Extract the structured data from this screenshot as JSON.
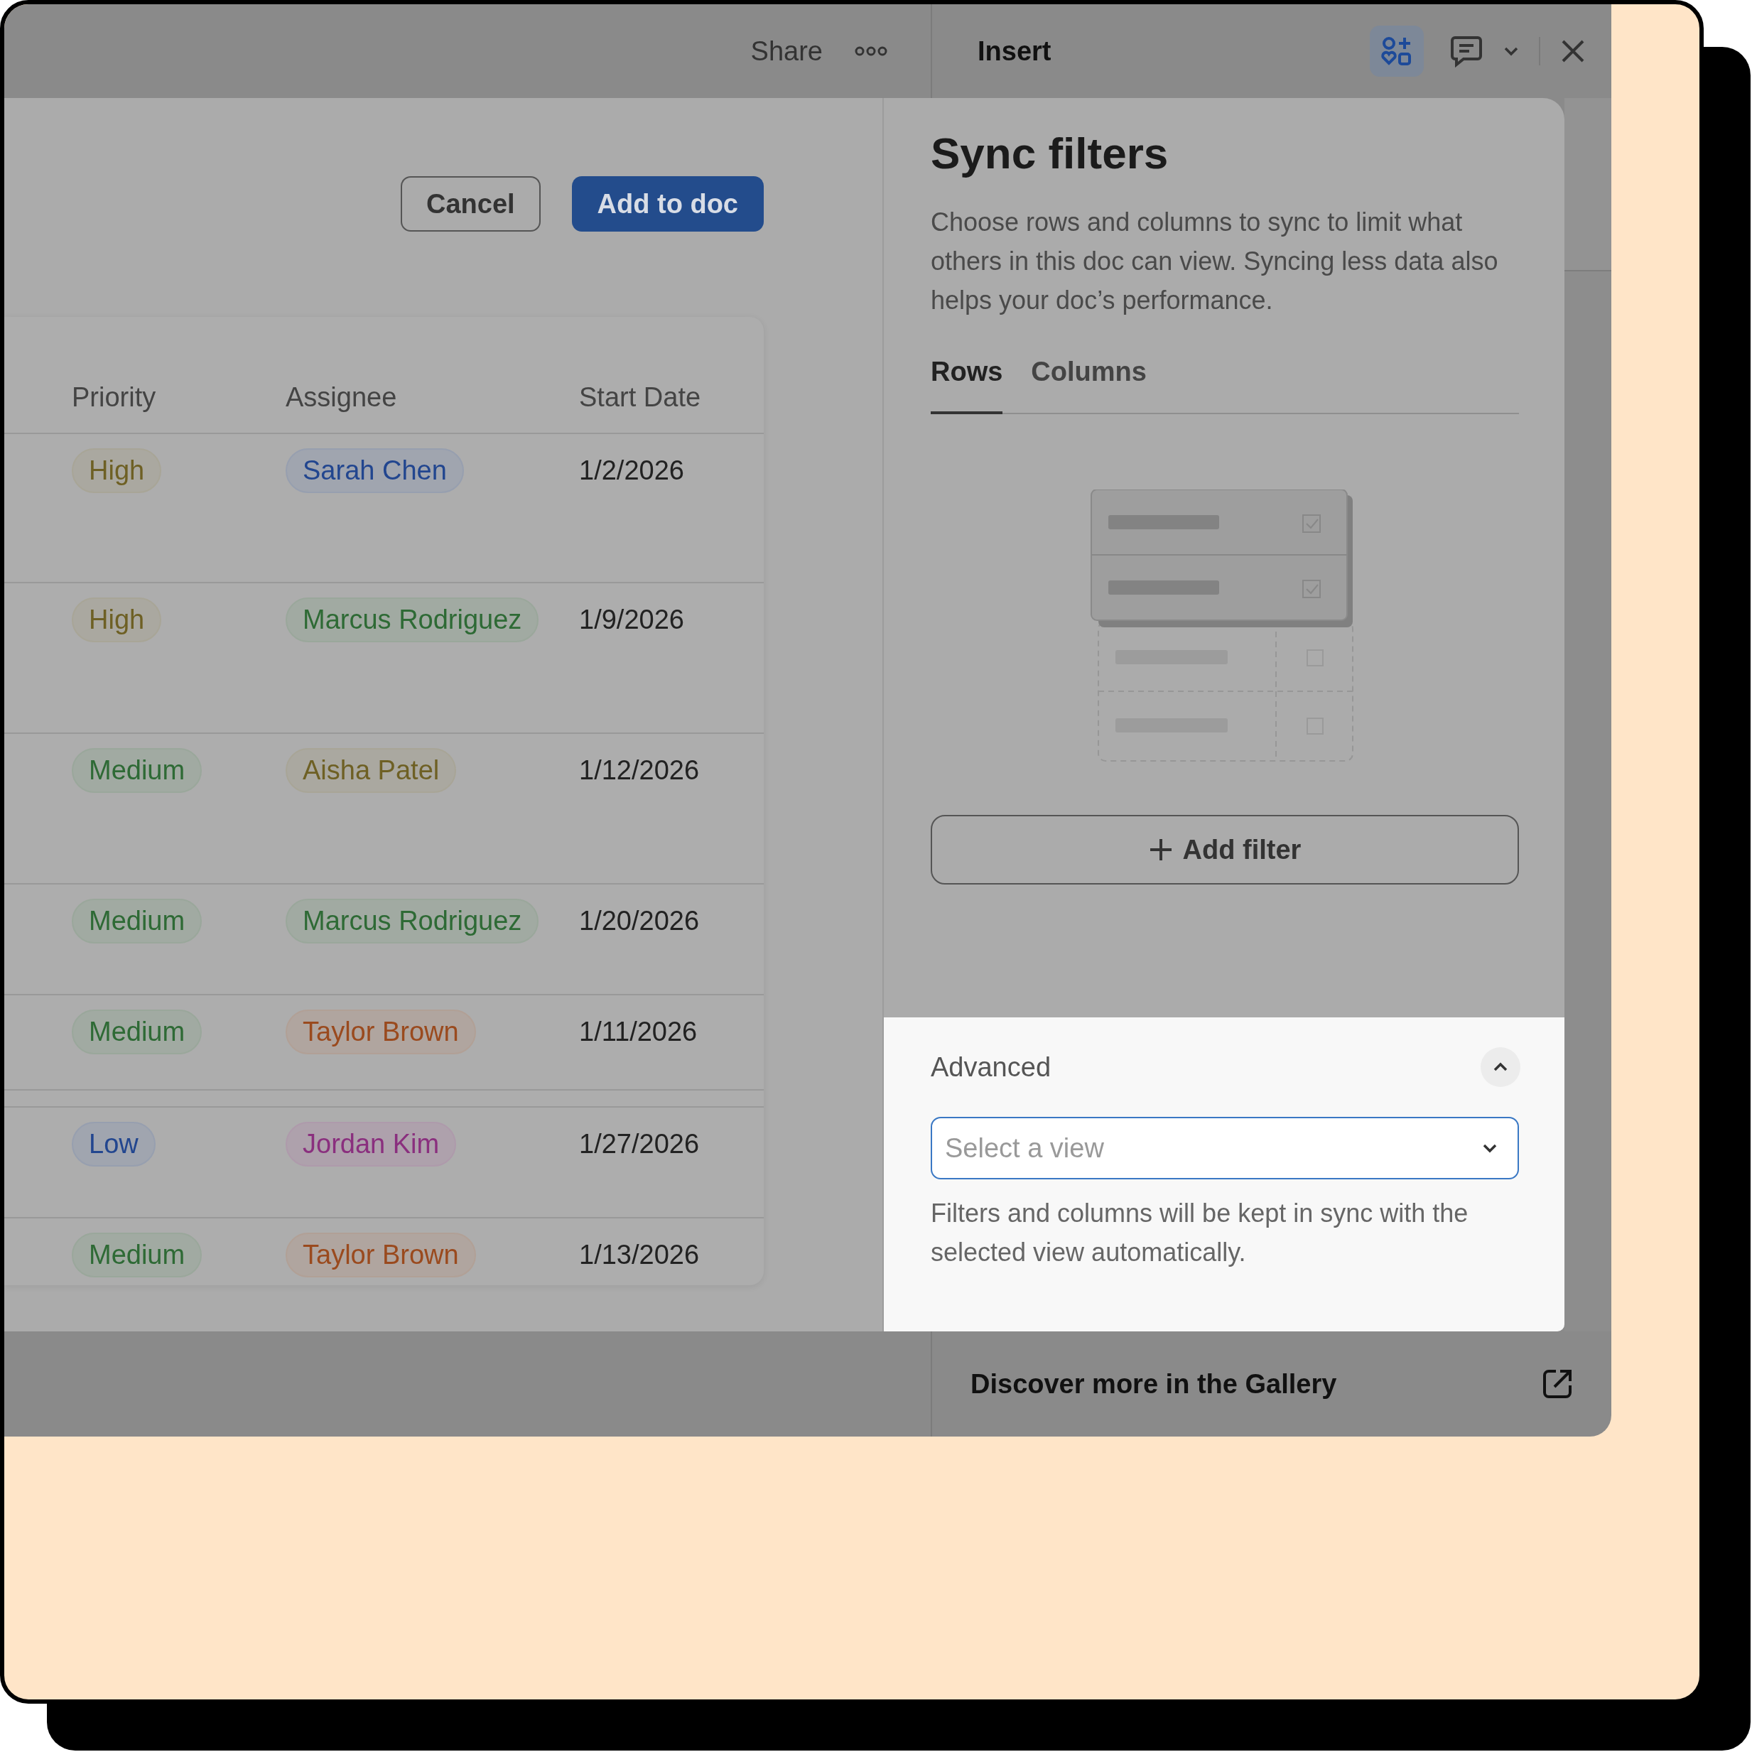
{
  "top_bar": {
    "share": "Share",
    "panel_title": "Insert"
  },
  "dialog": {
    "buttons": [
      {
        "label": "Cancel",
        "kind": "secondary"
      },
      {
        "label": "Add to doc",
        "kind": "primary"
      }
    ]
  },
  "table": {
    "columns": [
      "Priority",
      "Assignee",
      "Start Date"
    ],
    "rows": [
      {
        "priority": {
          "label": "High",
          "color": "#6e6024"
        },
        "assignee": {
          "label": "Sarah Chen",
          "color": "#22468f"
        },
        "start_date": "1/2/2026"
      },
      {
        "priority": {
          "label": "High",
          "color": "#6e6024"
        },
        "assignee": {
          "label": "Marcus Rodriguez",
          "color": "#2e6a35"
        },
        "start_date": "1/9/2026"
      },
      {
        "priority": {
          "label": "Medium",
          "color": "#2e6a35"
        },
        "assignee": {
          "label": "Aisha Patel",
          "color": "#6e6024"
        },
        "start_date": "1/12/2026"
      },
      {
        "priority": {
          "label": "Medium",
          "color": "#2e6a35"
        },
        "assignee": {
          "label": "Marcus Rodriguez",
          "color": "#2e6a35"
        },
        "start_date": "1/20/2026"
      },
      {
        "priority": {
          "label": "Medium",
          "color": "#2e6a35"
        },
        "assignee": {
          "label": "Taylor Brown",
          "color": "#9a4a1e"
        },
        "start_date": "1/11/2026"
      },
      {
        "priority": {
          "label": "Low",
          "color": "#22468f"
        },
        "assignee": {
          "label": "Jordan Kim",
          "color": "#8a2f7e"
        },
        "start_date": "1/27/2026"
      },
      {
        "priority": {
          "label": "Medium",
          "color": "#2e6a35"
        },
        "assignee": {
          "label": "Taylor Brown",
          "color": "#9a4a1e"
        },
        "start_date": "1/13/2026"
      }
    ]
  },
  "sync_filters": {
    "title": "Sync filters",
    "description": "Choose rows and columns to sync to limit what others in this doc can view. Syncing less data also helps your doc’s performance.",
    "tabs": [
      {
        "label": "Rows",
        "selected": true
      },
      {
        "label": "Columns",
        "selected": false
      }
    ],
    "add_filter": "Add filter",
    "advanced": {
      "title": "Advanced",
      "expanded": true,
      "select": {
        "placeholder": "Select a view"
      },
      "hint": "Filters and columns will be kept in sync with the selected view automatically."
    }
  },
  "gallery_link": "Discover more in the Gallery"
}
